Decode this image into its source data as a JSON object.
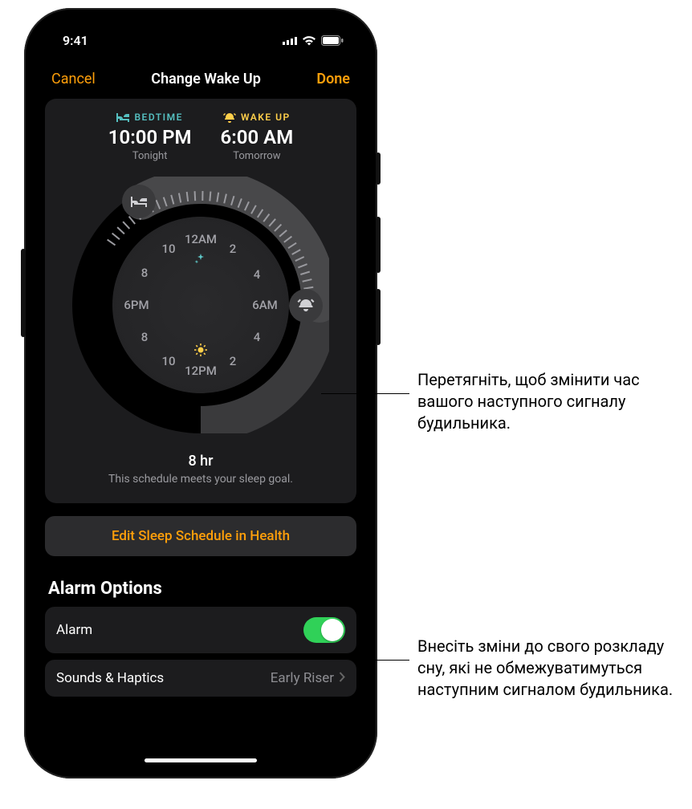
{
  "statusbar": {
    "time": "9:41"
  },
  "nav": {
    "cancel": "Cancel",
    "title": "Change Wake Up",
    "done": "Done"
  },
  "bedtime": {
    "label": "BEDTIME",
    "time": "10:00 PM",
    "sub": "Tonight"
  },
  "wakeup": {
    "label": "WAKE UP",
    "time": "6:00 AM",
    "sub": "Tomorrow"
  },
  "clock": {
    "labels": {
      "top": "12AM",
      "right": "6AM",
      "bottom": "12PM",
      "left": "6PM",
      "n2l": "10",
      "n2r": "2",
      "n4l": "8",
      "n4r": "4",
      "n8l": "8",
      "n8r": "4",
      "n10l": "10",
      "n10r": "2"
    }
  },
  "duration": {
    "val": "8 hr",
    "sub": "This schedule meets your sleep goal."
  },
  "edit": "Edit Sleep Schedule in Health",
  "options": {
    "title": "Alarm Options",
    "alarm_label": "Alarm",
    "sounds_label": "Sounds & Haptics",
    "sounds_value": "Early Riser"
  },
  "callouts": {
    "c1": "Перетягніть, щоб змінити час вашого наступного сигналу будильника.",
    "c2": "Внесіть зміни до свого розкладу сну, які не обмежуватимуться наступним сигналом будильника."
  },
  "chart_data": {
    "type": "pie",
    "title": "Sleep schedule arc on 24-hour dial",
    "bedtime_hour_24": 22,
    "wakeup_hour_24": 6,
    "sleep_duration_hours": 8,
    "dial_ticks": [
      "12AM",
      "2",
      "4",
      "6AM",
      "8",
      "10",
      "12PM",
      "2",
      "4",
      "6PM",
      "8",
      "10"
    ]
  }
}
